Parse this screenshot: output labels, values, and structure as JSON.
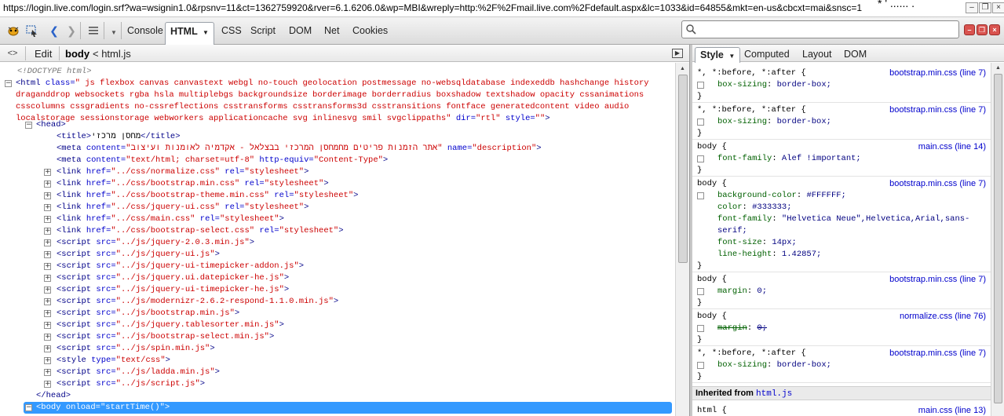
{
  "urlbar": {
    "url": "https://login.live.com/login.srf?wa=wsignin1.0&rpsnv=11&ct=1362759920&rver=6.1.6206.0&wp=MBI&wreply=http:%2F%2Fmail.live.com%2Fdefault.aspx&lc=1033&id=64855&mkt=en-us&cbcxt=mai&snsc=1",
    "tail": "* ' ......  ."
  },
  "toolbar": {
    "tabs": [
      "Console",
      "HTML",
      "CSS",
      "Script",
      "DOM",
      "Net",
      "Cookies"
    ],
    "selected_tab": "HTML",
    "search_placeholder": ""
  },
  "subbar": {
    "edit_label": "Edit",
    "crumb_current": "body",
    "crumb_parent": "< html.js"
  },
  "tree": {
    "doctype": "<!DOCTYPE html>",
    "html_open_tag": "<html",
    "html_class_attr": "class=",
    "html_class_value": "\" js flexbox canvas canvastext webgl no-touch geolocation postmessage no-websqldatabase indexeddb hashchange history draganddrop websockets rgba hsla multiplebgs backgroundsize borderimage borderradius boxshadow textshadow opacity cssanimations csscolumns cssgradients no-cssreflections csstransforms csstransforms3d csstransitions fontface generatedcontent video audio localstorage sessionstorage webworkers applicationcache svg inlinesvg smil svgclippaths\"",
    "html_dir_attr": "dir=",
    "html_dir_value": "\"rtl\"",
    "html_style_attr": "style=",
    "html_style_value": "\"\"",
    "html_close_bracket": ">",
    "head_open": "<head>",
    "title_open": "<title>",
    "title_text": "מחסן מרכזי",
    "title_close": "</title>",
    "meta1_tag": "<meta",
    "meta1_content_attr": "content=",
    "meta1_content_value": "\"אתר הזמנות פריטים מחמחסן המרכזי בבצלאל - אקדמיה לאומנות ועיצוב\"",
    "meta1_name_attr": "name=",
    "meta1_name_value": "\"description\"",
    "meta1_close": ">",
    "meta2_tag": "<meta",
    "meta2_content_attr": "content=",
    "meta2_content_value": "\"text/html; charset=utf-8\"",
    "meta2_equiv_attr": "http-equiv=",
    "meta2_equiv_value": "\"Content-Type\"",
    "meta2_close": ">",
    "links": [
      {
        "tag": "<link",
        "href_attr": "href=",
        "href": "\"../css/normalize.css\"",
        "rel_attr": "rel=",
        "rel": "\"stylesheet\"",
        "close": ">"
      },
      {
        "tag": "<link",
        "href_attr": "href=",
        "href": "\"../css/bootstrap.min.css\"",
        "rel_attr": "rel=",
        "rel": "\"stylesheet\"",
        "close": ">"
      },
      {
        "tag": "<link",
        "href_attr": "href=",
        "href": "\"../css/bootstrap-theme.min.css\"",
        "rel_attr": "rel=",
        "rel": "\"stylesheet\"",
        "close": ">"
      },
      {
        "tag": "<link",
        "href_attr": "href=",
        "href": "\"../css/jquery-ui.css\"",
        "rel_attr": "rel=",
        "rel": "\"stylesheet\"",
        "close": ">"
      },
      {
        "tag": "<link",
        "href_attr": "href=",
        "href": "\"../css/main.css\"",
        "rel_attr": "rel=",
        "rel": "\"stylesheet\"",
        "close": ">"
      },
      {
        "tag": "<link",
        "href_attr": "href=",
        "href": "\"../css/bootstrap-select.css\"",
        "rel_attr": "rel=",
        "rel": "\"stylesheet\"",
        "close": ">"
      }
    ],
    "scripts": [
      {
        "tag": "<script",
        "src_attr": "src=",
        "src": "\"../js/jquery-2.0.3.min.js\"",
        "close": ">"
      },
      {
        "tag": "<script",
        "src_attr": "src=",
        "src": "\"../js/jquery-ui.js\"",
        "close": ">"
      },
      {
        "tag": "<script",
        "src_attr": "src=",
        "src": "\"../js/jquery-ui-timepicker-addon.js\"",
        "close": ">"
      },
      {
        "tag": "<script",
        "src_attr": "src=",
        "src": "\"../js/jquery.ui.datepicker-he.js\"",
        "close": ">"
      },
      {
        "tag": "<script",
        "src_attr": "src=",
        "src": "\"../js/jquery-ui-timepicker-he.js\"",
        "close": ">"
      },
      {
        "tag": "<script",
        "src_attr": "src=",
        "src": "\"../js/modernizr-2.6.2-respond-1.1.0.min.js\"",
        "close": ">"
      },
      {
        "tag": "<script",
        "src_attr": "src=",
        "src": "\"../js/bootstrap.min.js\"",
        "close": ">"
      },
      {
        "tag": "<script",
        "src_attr": "src=",
        "src": "\"../js/jquery.tablesorter.min.js\"",
        "close": ">"
      },
      {
        "tag": "<script",
        "src_attr": "src=",
        "src": "\"../js/bootstrap-select.min.js\"",
        "close": ">"
      },
      {
        "tag": "<script",
        "src_attr": "src=",
        "src": "\"../js/spin.min.js\"",
        "close": ">"
      }
    ],
    "style_tag": "<style",
    "style_type_attr": "type=",
    "style_type_value": "\"text/css\"",
    "style_close": ">",
    "scripts_after": [
      {
        "tag": "<script",
        "src_attr": "src=",
        "src": "\"../js/ladda.min.js\"",
        "close": ">"
      },
      {
        "tag": "<script",
        "src_attr": "src=",
        "src": "\"../js/script.js\"",
        "close": ">"
      }
    ],
    "head_close": "</head>",
    "body_tag": "<body",
    "body_onload_attr": "onload=",
    "body_onload_value": "\"startTime()\"",
    "body_close": ">"
  },
  "side": {
    "tabs": [
      "Style",
      "Computed",
      "Layout",
      "DOM"
    ],
    "selected_tab": "Style",
    "rules": [
      {
        "selector": "*, *:before, *:after {",
        "source": "bootstrap.min.css (line 7)",
        "decls": [
          {
            "prop": "box-sizing",
            "value": "border-box;",
            "over": false
          }
        ]
      },
      {
        "selector": "*, *:before, *:after {",
        "source": "bootstrap.min.css (line 7)",
        "decls": [
          {
            "prop": "box-sizing",
            "value": "border-box;",
            "over": false
          }
        ]
      },
      {
        "selector": "body {",
        "source": "main.css (line 14)",
        "decls": [
          {
            "prop": "font-family",
            "value": "Alef !important;",
            "over": false
          }
        ]
      },
      {
        "selector": "body {",
        "source": "bootstrap.min.css (line 7)",
        "decls": [
          {
            "prop": "background-color",
            "value": "#FFFFFF;",
            "over": false
          },
          {
            "prop": "color",
            "value": "#333333;",
            "over": false
          },
          {
            "prop": "font-family",
            "value": "\"Helvetica Neue\",Helvetica,Arial,sans-serif;",
            "over": false
          },
          {
            "prop": "font-size",
            "value": "14px;",
            "over": false
          },
          {
            "prop": "line-height",
            "value": "1.42857;",
            "over": false
          }
        ]
      },
      {
        "selector": "body {",
        "source": "bootstrap.min.css (line 7)",
        "decls": [
          {
            "prop": "margin",
            "value": "0;",
            "over": false
          }
        ]
      },
      {
        "selector": "body {",
        "source": "normalize.css (line 76)",
        "decls": [
          {
            "prop": "margin",
            "value": "0;",
            "over": true
          }
        ]
      },
      {
        "selector": "*, *:before, *:after {",
        "source": "bootstrap.min.css (line 7)",
        "decls": [
          {
            "prop": "box-sizing",
            "value": "border-box;",
            "over": false
          }
        ]
      }
    ],
    "close_brace": "}",
    "inherited_label": "Inherited from",
    "inherited_link": "html.js",
    "last_rule": {
      "selector": "html {",
      "source": "main.css (line 13)"
    }
  }
}
